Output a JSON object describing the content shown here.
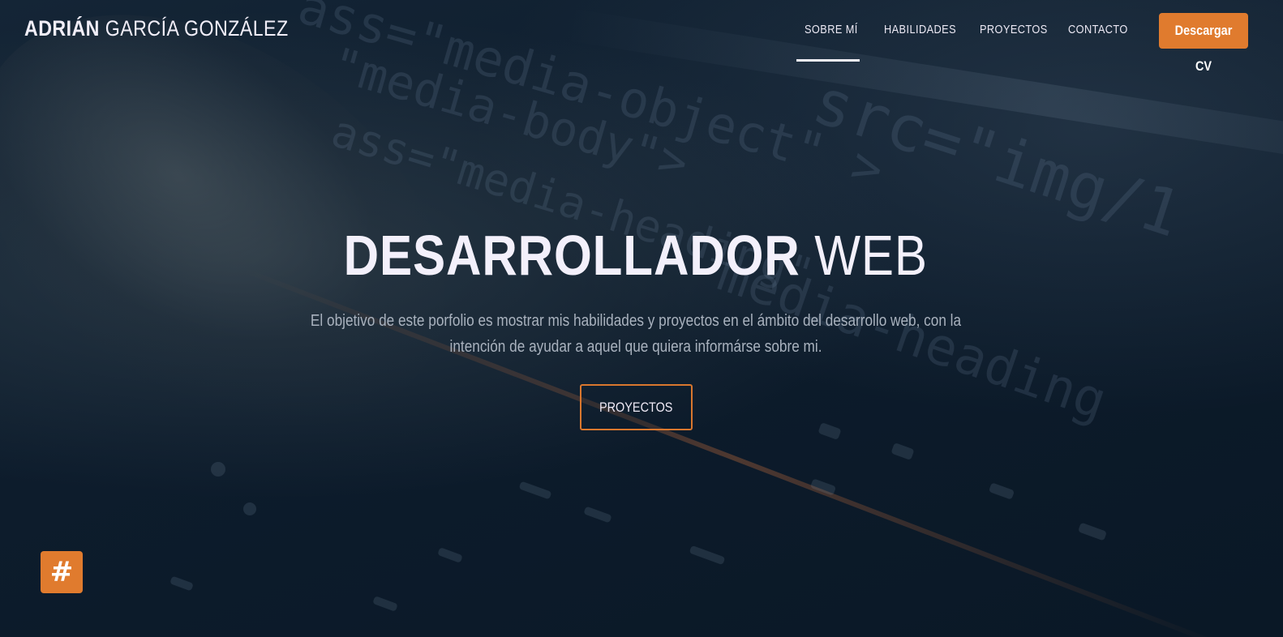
{
  "brand": {
    "first_name": "ADRIÁN",
    "last_name": "GARCÍA GONZÁLEZ"
  },
  "nav": {
    "items": [
      {
        "label": "SOBRE MÍ",
        "active": true
      },
      {
        "label": "HABILIDADES",
        "active": false
      },
      {
        "label": "PROYECTOS",
        "active": false
      },
      {
        "label": "CONTACTO",
        "active": false
      }
    ],
    "cv_button": "Descargar CV"
  },
  "hero": {
    "title_bold": "DESARROLLADOR",
    "title_light": "WEB",
    "description": "El objetivo de este porfolio es mostrar mis habilidades y proyectos en el ámbito del desarrollo web, con la intención de ayudar a aquel que quiera informárse sobre mi.",
    "button": "PROYECTOS"
  },
  "floating_button": {
    "label": "#",
    "icon": "hash-icon"
  },
  "colors": {
    "accent": "#e07b2e",
    "background": "#0c1b2b",
    "text": "#f3f0fb",
    "muted_text": "#a9b2be"
  }
}
